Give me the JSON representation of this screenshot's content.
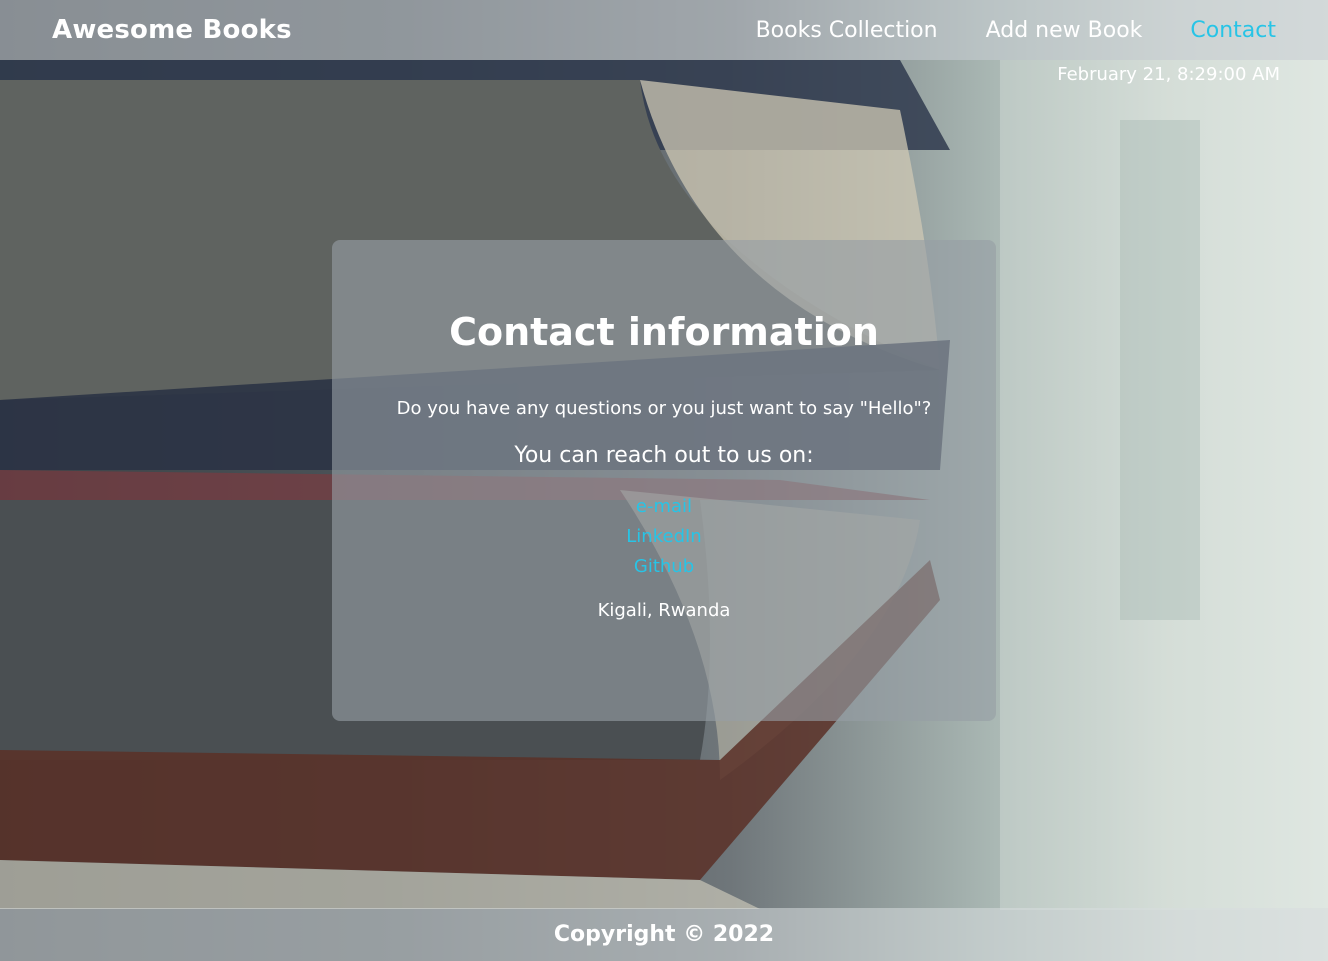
{
  "header": {
    "brand": "Awesome Books",
    "nav": [
      {
        "label": "Books Collection"
      },
      {
        "label": "Add new Book"
      },
      {
        "label": "Contact"
      }
    ],
    "active_nav": "Contact",
    "active_color": "#27c4e6"
  },
  "datetime": "February 21, 8:29:00 AM",
  "contact": {
    "title": "Contact information",
    "question": "Do you have any questions or you just want to say \"Hello\"?",
    "reach": "You can reach out to us on:",
    "links": [
      {
        "label": "e-mail"
      },
      {
        "label": "LinkedIn"
      },
      {
        "label": "Github"
      }
    ],
    "location": "Kigali, Rwanda"
  },
  "footer": {
    "copyright": "Copyright © 2022"
  }
}
